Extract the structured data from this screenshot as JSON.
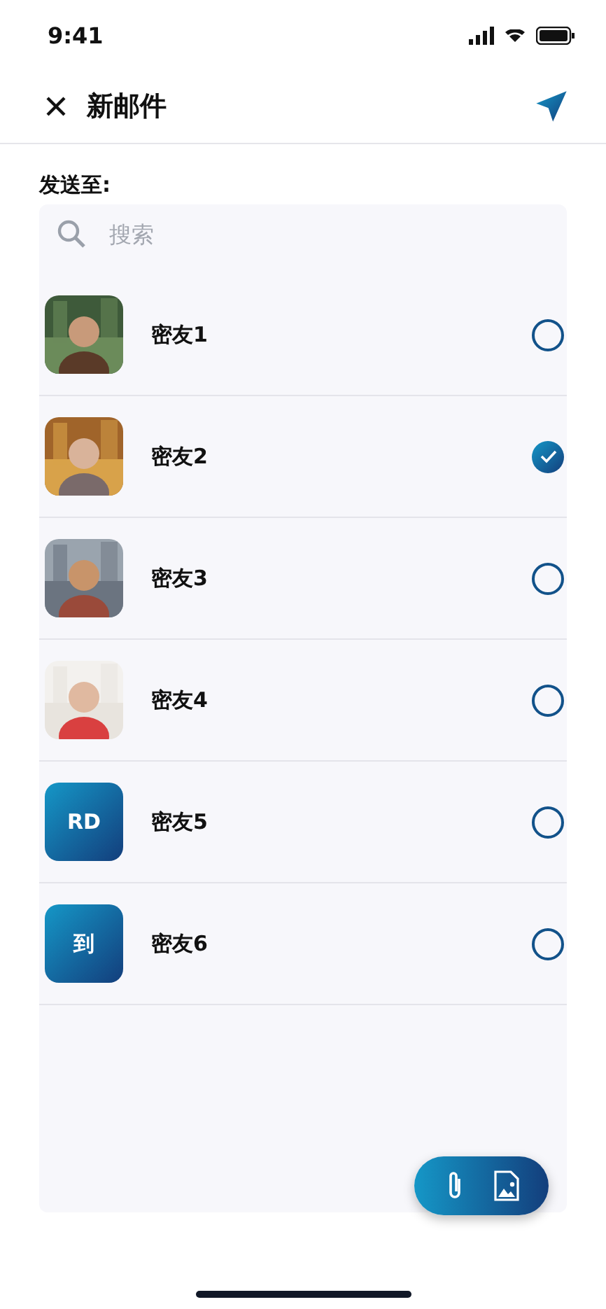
{
  "status_bar": {
    "time": "9:41"
  },
  "header": {
    "title": "新邮件"
  },
  "recipient_label": "发送至:",
  "search": {
    "placeholder": "搜索"
  },
  "contacts": [
    {
      "name": "密友1",
      "selected": false
    },
    {
      "name": "密友2",
      "selected": true
    },
    {
      "name": "密友3",
      "selected": false
    },
    {
      "name": "密友4",
      "selected": false
    },
    {
      "name": "密友5",
      "avatar": {
        "kind": "initials",
        "text": "RD"
      },
      "selected": false
    },
    {
      "name": "密友6",
      "avatar": {
        "kind": "initials",
        "text": "到"
      },
      "selected": false
    }
  ]
}
